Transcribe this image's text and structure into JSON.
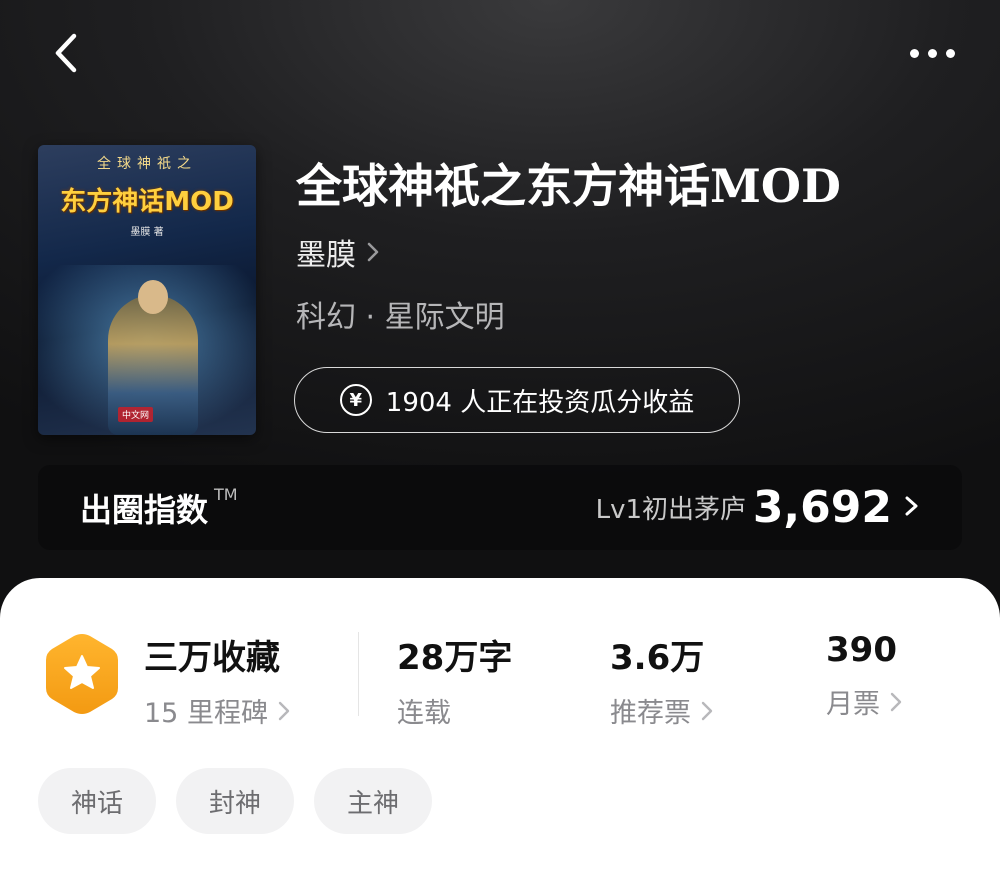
{
  "header": {
    "back_icon": "chevron-left-icon",
    "more_icon": "more-dots-icon"
  },
  "book": {
    "cover": {
      "top_text": "全球神祇之",
      "title_text": "东方神话MOD",
      "author_text": "墨膜 著",
      "badge_text": "中文网"
    },
    "title": "全球神祇之东方神话MOD",
    "author": "墨膜",
    "genre": "科幻 · 星际文明",
    "invest_text": "1904 人正在投资瓜分收益"
  },
  "popularity": {
    "label": "出圈指数",
    "tm": "TM",
    "level": "Lv1初出茅庐",
    "score": "3,692"
  },
  "stats": {
    "collect": {
      "main": "三万收藏",
      "sub": "15 里程碑"
    },
    "words": {
      "number": "28",
      "unit": "万字",
      "sub": "连载"
    },
    "recommend": {
      "number": "3.6",
      "unit": "万",
      "sub": "推荐票"
    },
    "monthly": {
      "number": "390",
      "sub": "月票"
    }
  },
  "tags": [
    "神话",
    "封神",
    "主神"
  ],
  "colors": {
    "accent": "#F5A623",
    "background_dark": "#1f1f21",
    "panel": "#ffffff"
  }
}
